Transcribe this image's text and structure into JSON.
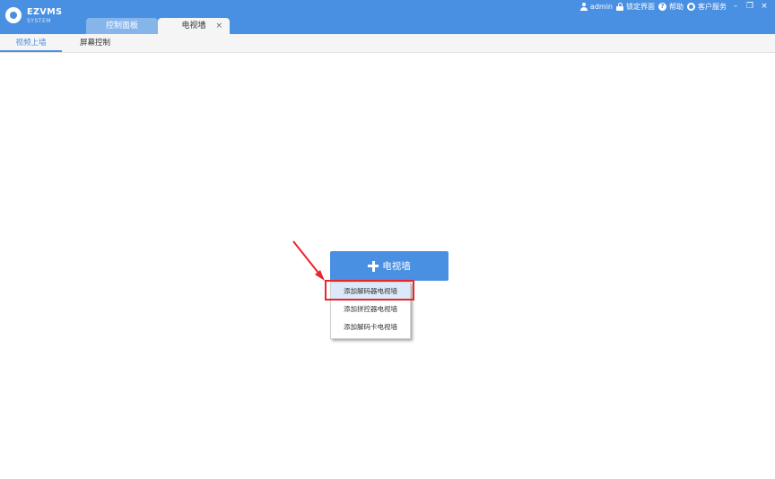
{
  "app": {
    "logo_title": "EZVMS",
    "logo_subtitle": "SYSTEM"
  },
  "tabs": [
    {
      "label": "控制面板",
      "active": false
    },
    {
      "label": "电视墙",
      "active": true,
      "close": "×"
    }
  ],
  "topbar": {
    "username": "admin",
    "lock": "锁定界面",
    "help": "帮助",
    "service": "客户服务",
    "minimize": "–",
    "restore": "❐",
    "close": "×"
  },
  "subtabs": [
    {
      "label": "视频上墙",
      "active": true
    },
    {
      "label": "屏幕控制",
      "active": false
    }
  ],
  "main": {
    "tv_button_label": "电视墙",
    "menu_items": [
      "添加解码器电视墙",
      "添加拼控器电视墙",
      "添加解码卡电视墙"
    ]
  },
  "colors": {
    "accent": "#4a90e2",
    "highlight": "#e8262b"
  }
}
